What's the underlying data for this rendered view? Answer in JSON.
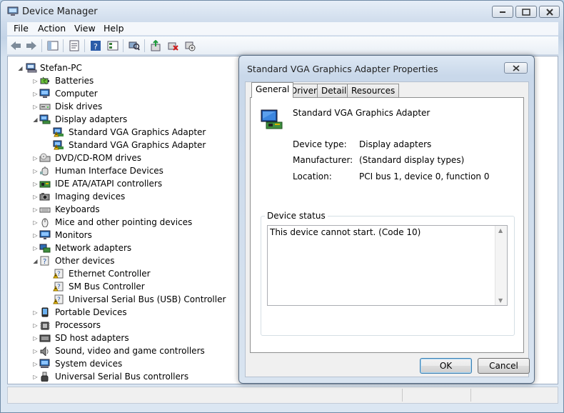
{
  "window": {
    "title": "Device Manager"
  },
  "menu": [
    "File",
    "Action",
    "View",
    "Help"
  ],
  "toolbar": [
    "back-icon",
    "forward-icon",
    "show-hide-console-tree-icon",
    "properties-icon",
    "help-icon",
    "view-icon",
    "scan-hardware-icon",
    "update-driver-icon",
    "uninstall-icon",
    "disable-icon"
  ],
  "tree": {
    "root": "Stefan-PC",
    "items": [
      {
        "label": "Batteries",
        "level": 1,
        "exp": "collapsed",
        "icon": "battery-icon"
      },
      {
        "label": "Computer",
        "level": 1,
        "exp": "collapsed",
        "icon": "computer-icon"
      },
      {
        "label": "Disk drives",
        "level": 1,
        "exp": "collapsed",
        "icon": "disk-drive-icon"
      },
      {
        "label": "Display adapters",
        "level": 1,
        "exp": "expanded",
        "icon": "display-adapter-icon"
      },
      {
        "label": "Standard VGA Graphics Adapter",
        "level": 2,
        "exp": "none",
        "icon": "warning-display-icon"
      },
      {
        "label": "Standard VGA Graphics Adapter",
        "level": 2,
        "exp": "none",
        "icon": "warning-display-icon"
      },
      {
        "label": "DVD/CD-ROM drives",
        "level": 1,
        "exp": "collapsed",
        "icon": "dvd-drive-icon"
      },
      {
        "label": "Human Interface Devices",
        "level": 1,
        "exp": "collapsed",
        "icon": "hid-icon"
      },
      {
        "label": "IDE ATA/ATAPI controllers",
        "level": 1,
        "exp": "collapsed",
        "icon": "ide-controller-icon"
      },
      {
        "label": "Imaging devices",
        "level": 1,
        "exp": "collapsed",
        "icon": "camera-icon"
      },
      {
        "label": "Keyboards",
        "level": 1,
        "exp": "collapsed",
        "icon": "keyboard-icon"
      },
      {
        "label": "Mice and other pointing devices",
        "level": 1,
        "exp": "collapsed",
        "icon": "mouse-icon"
      },
      {
        "label": "Monitors",
        "level": 1,
        "exp": "collapsed",
        "icon": "monitor-icon"
      },
      {
        "label": "Network adapters",
        "level": 1,
        "exp": "collapsed",
        "icon": "network-adapter-icon"
      },
      {
        "label": "Other devices",
        "level": 1,
        "exp": "expanded",
        "icon": "unknown-device-icon"
      },
      {
        "label": "Ethernet Controller",
        "level": 2,
        "exp": "none",
        "icon": "warning-unknown-icon"
      },
      {
        "label": "SM Bus Controller",
        "level": 2,
        "exp": "none",
        "icon": "warning-unknown-icon"
      },
      {
        "label": "Universal Serial Bus (USB) Controller",
        "level": 2,
        "exp": "none",
        "icon": "warning-unknown-icon"
      },
      {
        "label": "Portable Devices",
        "level": 1,
        "exp": "collapsed",
        "icon": "portable-device-icon"
      },
      {
        "label": "Processors",
        "level": 1,
        "exp": "collapsed",
        "icon": "processor-icon"
      },
      {
        "label": "SD host adapters",
        "level": 1,
        "exp": "collapsed",
        "icon": "sd-host-icon"
      },
      {
        "label": "Sound, video and game controllers",
        "level": 1,
        "exp": "collapsed",
        "icon": "sound-icon"
      },
      {
        "label": "System devices",
        "level": 1,
        "exp": "collapsed",
        "icon": "system-device-icon"
      },
      {
        "label": "Universal Serial Bus controllers",
        "level": 1,
        "exp": "collapsed",
        "icon": "usb-icon"
      }
    ]
  },
  "dialog": {
    "title": "Standard VGA Graphics Adapter Properties",
    "tabs": [
      "General",
      "Driver",
      "Details",
      "Resources"
    ],
    "active_tab": "General",
    "device_name": "Standard VGA Graphics Adapter",
    "props": [
      {
        "key": "Device type:",
        "value": "Display adapters"
      },
      {
        "key": "Manufacturer:",
        "value": "(Standard display types)"
      },
      {
        "key": "Location:",
        "value": "PCI bus 1, device 0, function 0"
      }
    ],
    "status_group_label": "Device status",
    "status_text": "This device cannot start. (Code 10)",
    "ok_label": "OK",
    "cancel_label": "Cancel"
  },
  "colors": {
    "accent": "#3c7fb1",
    "warning": "#f2c200"
  }
}
